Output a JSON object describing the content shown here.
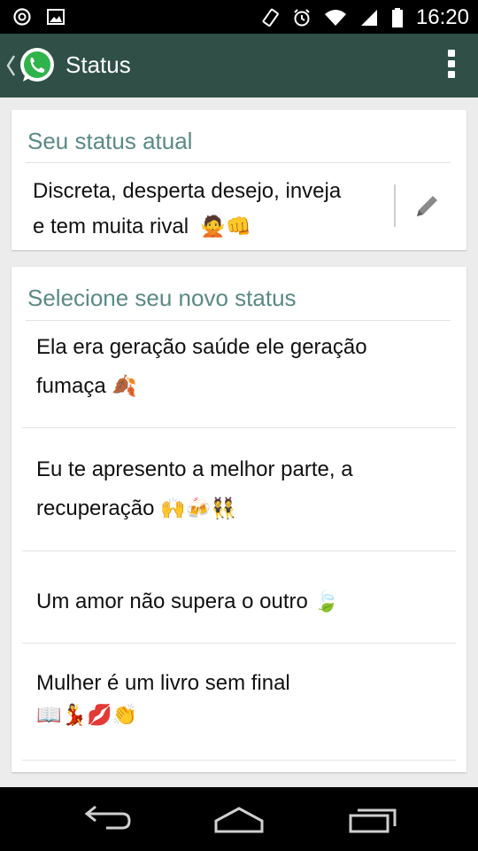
{
  "status_bar": {
    "time": "16:20",
    "icons": [
      "whatsapp-notification-icon",
      "image-notification-icon",
      "vibrate-icon",
      "alarm-icon",
      "wifi-icon",
      "signal-icon",
      "battery-icon"
    ]
  },
  "action_bar": {
    "title": "Status",
    "icons": [
      "back-chevron-icon",
      "whatsapp-logo-icon",
      "overflow-menu-icon"
    ]
  },
  "current_status": {
    "header": "Seu status atual",
    "text_line1": "Discreta, desperta desejo, inveja",
    "text_line2": "e tem muita rival",
    "emojis": "🙅👊",
    "edit_icon": "pencil-icon"
  },
  "new_status": {
    "header": "Selecione seu novo status",
    "options": [
      {
        "line1": "Ela era geração saúde ele geração",
        "line2": "fumaça",
        "emojis": "🍂"
      },
      {
        "line1": "Eu te apresento a melhor parte, a",
        "line2": "recuperação",
        "emojis": "🙌🍻👯"
      },
      {
        "line1": "Um amor não supera o outro",
        "emojis": "🍃"
      },
      {
        "line1": "Mulher é um livro sem final",
        "emojis": "📖💃💋👏"
      }
    ]
  },
  "nav_bar": {
    "icons": [
      "back-icon",
      "home-icon",
      "recent-apps-icon"
    ]
  },
  "colors": {
    "action_bar": "#2f4f47",
    "section_header": "#5a8a84",
    "background": "#ececec"
  }
}
